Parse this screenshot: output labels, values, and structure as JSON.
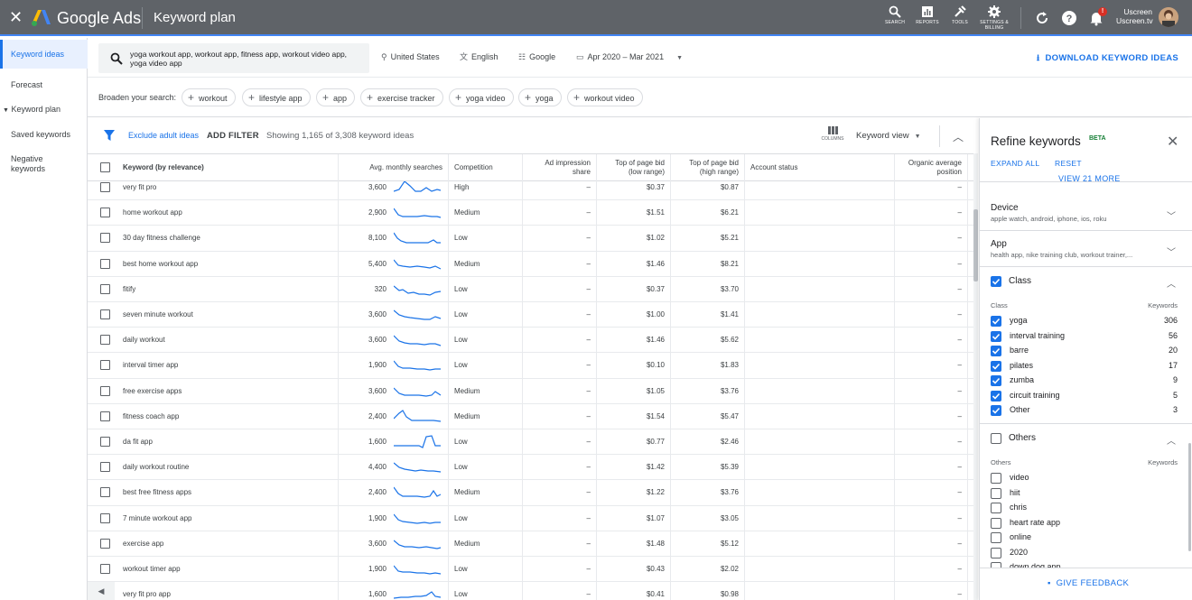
{
  "topbar": {
    "brand": "Google Ads",
    "page_title": "Keyword plan",
    "tools": [
      {
        "icon": "search-icon",
        "label": "SEARCH"
      },
      {
        "icon": "reports-icon",
        "label": "REPORTS"
      },
      {
        "icon": "tools-icon",
        "label": "TOOLS"
      },
      {
        "icon": "settings-icon",
        "label": "SETTINGS & BILLING"
      }
    ],
    "notification_badge": "!",
    "user_line1": "Uscreen",
    "user_line2": "Uscreen.tv"
  },
  "nav": {
    "items": [
      "Keyword ideas",
      "Forecast",
      "Keyword plan",
      "Saved keywords",
      "Negative keywords"
    ]
  },
  "search": {
    "query": "yoga workout app, workout app, fitness app, workout video app, yoga video app",
    "location": "United States",
    "language": "English",
    "network": "Google",
    "date_range": "Apr 2020 – Mar 2021",
    "download_label": "DOWNLOAD KEYWORD IDEAS"
  },
  "broaden": {
    "label": "Broaden your search:",
    "chips": [
      "workout",
      "lifestyle app",
      "app",
      "exercise tracker",
      "yoga video",
      "yoga",
      "workout video"
    ]
  },
  "filterbar": {
    "exclude_adult": "Exclude adult ideas",
    "add_filter": "ADD FILTER",
    "showing": "Showing 1,165 of 3,308 keyword ideas",
    "columns_label": "COLUMNS",
    "view_label": "Keyword view"
  },
  "table": {
    "headers": [
      "Keyword (by relevance)",
      "Avg. monthly searches",
      "Competition",
      "Ad impression share",
      "Top of page bid (low range)",
      "Top of page bid (high range)",
      "Account status",
      "Organic average position"
    ],
    "rows": [
      {
        "keyword": "very fit pro",
        "searches": "3,600",
        "competition": "High",
        "share": "–",
        "low": "$0.37",
        "high": "$0.87",
        "organic": "–"
      },
      {
        "keyword": "home workout app",
        "searches": "2,900",
        "competition": "Medium",
        "share": "–",
        "low": "$1.51",
        "high": "$6.21",
        "organic": "–"
      },
      {
        "keyword": "30 day fitness challenge",
        "searches": "8,100",
        "competition": "Low",
        "share": "–",
        "low": "$1.02",
        "high": "$5.21",
        "organic": "–"
      },
      {
        "keyword": "best home workout app",
        "searches": "5,400",
        "competition": "Medium",
        "share": "–",
        "low": "$1.46",
        "high": "$8.21",
        "organic": "–"
      },
      {
        "keyword": "fitify",
        "searches": "320",
        "competition": "Low",
        "share": "–",
        "low": "$0.37",
        "high": "$3.70",
        "organic": "–"
      },
      {
        "keyword": "seven minute workout",
        "searches": "3,600",
        "competition": "Low",
        "share": "–",
        "low": "$1.00",
        "high": "$1.41",
        "organic": "–"
      },
      {
        "keyword": "daily workout",
        "searches": "3,600",
        "competition": "Low",
        "share": "–",
        "low": "$1.46",
        "high": "$5.62",
        "organic": "–"
      },
      {
        "keyword": "interval timer app",
        "searches": "1,900",
        "competition": "Low",
        "share": "–",
        "low": "$0.10",
        "high": "$1.83",
        "organic": "–"
      },
      {
        "keyword": "free exercise apps",
        "searches": "3,600",
        "competition": "Medium",
        "share": "–",
        "low": "$1.05",
        "high": "$3.76",
        "organic": "–"
      },
      {
        "keyword": "fitness coach app",
        "searches": "2,400",
        "competition": "Medium",
        "share": "–",
        "low": "$1.54",
        "high": "$5.47",
        "organic": "–"
      },
      {
        "keyword": "da fit app",
        "searches": "1,600",
        "competition": "Low",
        "share": "–",
        "low": "$0.77",
        "high": "$2.46",
        "organic": "–"
      },
      {
        "keyword": "daily workout routine",
        "searches": "4,400",
        "competition": "Low",
        "share": "–",
        "low": "$1.42",
        "high": "$5.39",
        "organic": "–"
      },
      {
        "keyword": "best free fitness apps",
        "searches": "2,400",
        "competition": "Medium",
        "share": "–",
        "low": "$1.22",
        "high": "$3.76",
        "organic": "–"
      },
      {
        "keyword": "7 minute workout app",
        "searches": "1,900",
        "competition": "Low",
        "share": "–",
        "low": "$1.07",
        "high": "$3.05",
        "organic": "–"
      },
      {
        "keyword": "exercise app",
        "searches": "3,600",
        "competition": "Medium",
        "share": "–",
        "low": "$1.48",
        "high": "$5.12",
        "organic": "–"
      },
      {
        "keyword": "workout timer app",
        "searches": "1,900",
        "competition": "Low",
        "share": "–",
        "low": "$0.43",
        "high": "$2.02",
        "organic": "–"
      },
      {
        "keyword": "very fit pro app",
        "searches": "1,600",
        "competition": "Low",
        "share": "–",
        "low": "$0.41",
        "high": "$0.98",
        "organic": "–"
      }
    ]
  },
  "panel": {
    "title": "Refine keywords",
    "beta": "BETA",
    "expand_all": "EXPAND ALL",
    "reset": "RESET",
    "view_more": "VIEW 21 MORE",
    "device": {
      "title": "Device",
      "subtitle": "apple watch, android, iphone, ios, roku"
    },
    "app": {
      "title": "App",
      "subtitle": "health app, nike training club, workout trainer,..."
    },
    "class": {
      "title": "Class",
      "col_left": "Class",
      "col_right": "Keywords",
      "items": [
        {
          "label": "yoga",
          "count": "306"
        },
        {
          "label": "interval training",
          "count": "56"
        },
        {
          "label": "barre",
          "count": "20"
        },
        {
          "label": "pilates",
          "count": "17"
        },
        {
          "label": "zumba",
          "count": "9"
        },
        {
          "label": "circuit training",
          "count": "5"
        },
        {
          "label": "Other",
          "count": "3"
        }
      ]
    },
    "others": {
      "title": "Others",
      "col_left": "Others",
      "col_right": "Keywords",
      "items": [
        "video",
        "hiit",
        "chris",
        "heart rate app",
        "online",
        "2020",
        "down dog app"
      ]
    },
    "feedback": "GIVE FEEDBACK"
  },
  "colors": {
    "accent": "#1a73e8",
    "topbar": "#5f6368",
    "beta": "#188038",
    "badge": "#d93025"
  }
}
